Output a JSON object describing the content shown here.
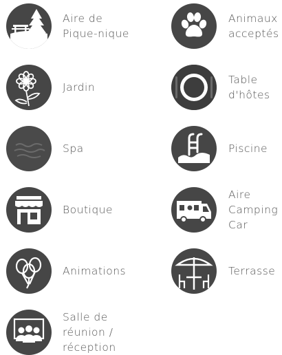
{
  "amenities": {
    "picnic_area": {
      "label": "Aire de\nPique-nique",
      "icon": "picnic-tree-icon"
    },
    "pets_allowed": {
      "label": "Animaux\nacceptés",
      "icon": "paw-icon"
    },
    "garden": {
      "label": "Jardin",
      "icon": "flower-icon"
    },
    "guest_table": {
      "label": "Table\nd'hôtes",
      "icon": "plate-icon"
    },
    "spa": {
      "label": "Spa",
      "icon": "spa-icon"
    },
    "pool": {
      "label": "Piscine",
      "icon": "pool-ladder-icon"
    },
    "shop": {
      "label": "Boutique",
      "icon": "shop-icon"
    },
    "camper_area": {
      "label": "Aire\nCamping\nCar",
      "icon": "camper-van-icon"
    },
    "animations": {
      "label": "Animations",
      "icon": "balloons-icon"
    },
    "terrace": {
      "label": "Terrasse",
      "icon": "parasol-table-icon"
    },
    "meeting_room": {
      "label": "Salle de\nréunion /\nréception",
      "icon": "meeting-people-icon"
    }
  },
  "colors": {
    "icon_background": "#464646",
    "icon_foreground": "#ffffff",
    "label_text": "#555555"
  }
}
